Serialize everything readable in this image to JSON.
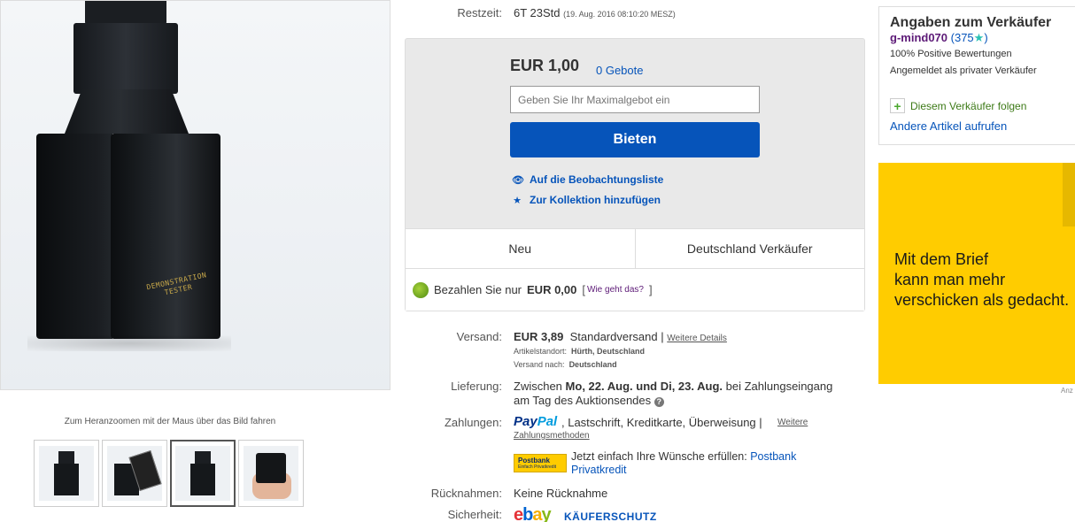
{
  "gallery": {
    "main_image_label_line1": "DEMONSTRATION",
    "main_image_label_line2": "TESTER",
    "zoom_hint": "Zum Heranzoomen mit der Maus über das Bild fahren",
    "thumbnail_count": 4,
    "active_thumbnail": 3
  },
  "auction": {
    "remaining_label": "Restzeit:",
    "remaining_value": "6T 23Std",
    "remaining_date": "(19. Aug. 2016   08:10:20 MESZ)",
    "price": "EUR 1,00",
    "bids": "0 Gebote",
    "max_bid_placeholder": "Geben Sie Ihr Maximalgebot ein",
    "bid_button": "Bieten",
    "watchlist_link": "Auf die Beobachtungsliste",
    "collection_link": "Zur Kollektion hinzufügen",
    "condition": "Neu",
    "seller_location": "Deutschland Verkäufer",
    "pay_prefix": "Bezahlen Sie nur",
    "pay_amount": "EUR 0,00",
    "pay_bracket_open": "[",
    "pay_how_link": "Wie geht das?",
    "pay_bracket_close": "]"
  },
  "details": {
    "shipping_label": "Versand:",
    "shipping_price": "EUR 3,89",
    "shipping_method": "Standardversand",
    "shipping_sep": "|",
    "shipping_more": "Weitere Details",
    "location_label": "Artikelstandort:",
    "location_value": "Hürth, Deutschland",
    "ship_to_label": "Versand nach:",
    "ship_to_value": "Deutschland",
    "delivery_label": "Lieferung:",
    "delivery_prefix": "Zwischen",
    "delivery_from": "Mo, 22. Aug.",
    "delivery_and": "und",
    "delivery_to": "Di, 23. Aug.",
    "delivery_suffix": "bei Zahlungseingang",
    "delivery_line2": "am Tag des Auktionsendes",
    "payment_label": "Zahlungen:",
    "paypal_part1": "Pay",
    "paypal_part2": "Pal",
    "payment_methods": ",  Lastschrift,  Kreditkarte,  Überweisung  |",
    "payment_more_1": "Weitere",
    "payment_more_2": "Zahlungsmethoden",
    "postbank_logo": "Postbank",
    "postbank_logo_sub": "Einfach Privatkredit",
    "postbank_text": "Jetzt einfach Ihre Wünsche erfüllen:",
    "postbank_link_1": "Postbank",
    "postbank_link_2": "Privatkredit",
    "returns_label": "Rücknahmen:",
    "returns_value": "Keine Rücknahme",
    "security_label": "Sicherheit:",
    "ebay_e": "e",
    "ebay_b": "b",
    "ebay_a": "a",
    "ebay_y": "y",
    "buyer_protection": "KÄUFERSCHUTZ"
  },
  "seller": {
    "title": "Angaben zum Verkäufer",
    "name": "g-mind070",
    "score_open": "(375",
    "score_close": ")",
    "positive": "100% Positive Bewertungen",
    "registered": "Angemeldet als privater Verkäufer",
    "follow": "Diesem Verkäufer folgen",
    "other_items": "Andere Artikel aufrufen"
  },
  "ad": {
    "line1": "Mit dem Brief",
    "line2": "kann man mehr",
    "line3": "verschicken als gedacht.",
    "caption": "Anz"
  },
  "colors": {
    "link_blue": "#0654ba",
    "ad_yellow": "#ffcc00",
    "seller_purple": "#5d1a77"
  }
}
